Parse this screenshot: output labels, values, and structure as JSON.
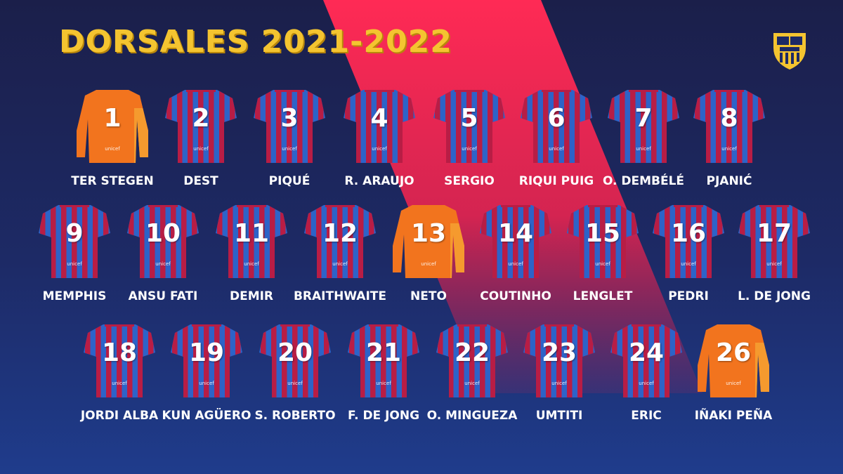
{
  "title": "DORSALES 2021-2022",
  "crest_icon": "fc-barcelona-crest-icon",
  "colors": {
    "background_navy": "#1d2a66",
    "diagonal_red": "#ff2a55",
    "title_yellow": "#f4c430",
    "home_blue": "#2d63c8",
    "home_garnet": "#b81d45",
    "goalkeeper_orange": "#f2741e"
  },
  "sponsor": "unicef",
  "players": [
    {
      "number": "1",
      "name": "TER STEGEN",
      "kit": "goalkeeper"
    },
    {
      "number": "2",
      "name": "DEST",
      "kit": "home"
    },
    {
      "number": "3",
      "name": "PIQUÉ",
      "kit": "home"
    },
    {
      "number": "4",
      "name": "R. ARAUJO",
      "kit": "home"
    },
    {
      "number": "5",
      "name": "SERGIO",
      "kit": "home"
    },
    {
      "number": "6",
      "name": "RIQUI PUIG",
      "kit": "home"
    },
    {
      "number": "7",
      "name": "O. DEMBÉLÉ",
      "kit": "home"
    },
    {
      "number": "8",
      "name": "PJANIĆ",
      "kit": "home"
    },
    {
      "number": "9",
      "name": "MEMPHIS",
      "kit": "home"
    },
    {
      "number": "10",
      "name": "ANSU FATI",
      "kit": "home"
    },
    {
      "number": "11",
      "name": "DEMIR",
      "kit": "home"
    },
    {
      "number": "12",
      "name": "BRAITHWAITE",
      "kit": "home"
    },
    {
      "number": "13",
      "name": "NETO",
      "kit": "goalkeeper"
    },
    {
      "number": "14",
      "name": "COUTINHO",
      "kit": "home"
    },
    {
      "number": "15",
      "name": "LENGLET",
      "kit": "home"
    },
    {
      "number": "16",
      "name": "PEDRI",
      "kit": "home"
    },
    {
      "number": "17",
      "name": "L. DE JONG",
      "kit": "home"
    },
    {
      "number": "18",
      "name": "JORDI ALBA",
      "kit": "home"
    },
    {
      "number": "19",
      "name": "KUN AGÜERO",
      "kit": "home"
    },
    {
      "number": "20",
      "name": "S. ROBERTO",
      "kit": "home"
    },
    {
      "number": "21",
      "name": "F. DE JONG",
      "kit": "home"
    },
    {
      "number": "22",
      "name": "O. MINGUEZA",
      "kit": "home"
    },
    {
      "number": "23",
      "name": "UMTITI",
      "kit": "home"
    },
    {
      "number": "24",
      "name": "ERIC",
      "kit": "home"
    },
    {
      "number": "26",
      "name": "IÑAKI PEÑA",
      "kit": "goalkeeper"
    }
  ]
}
